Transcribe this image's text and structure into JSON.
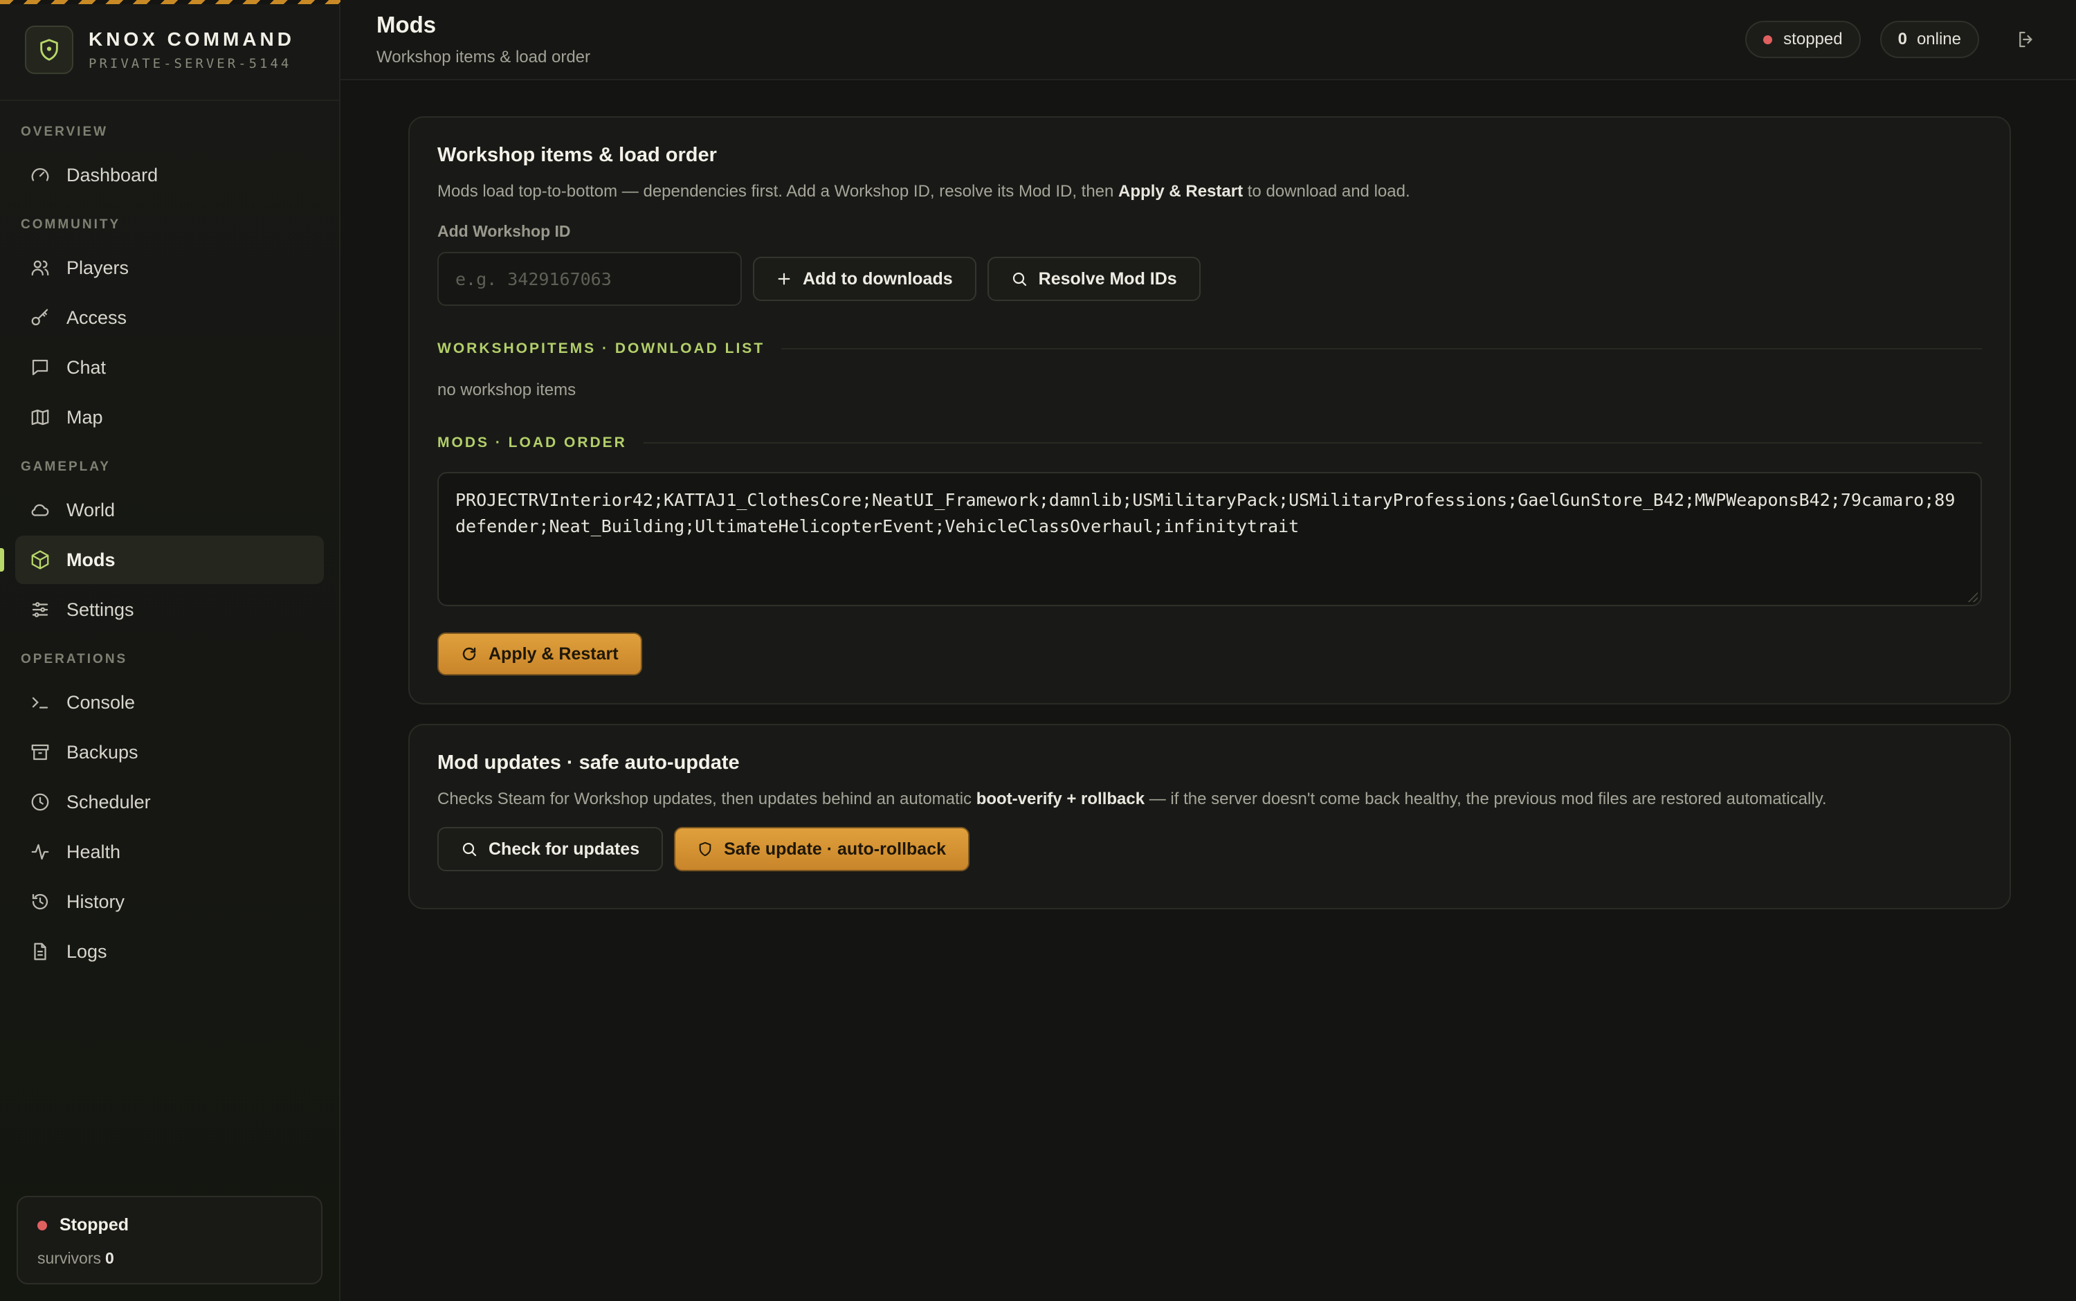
{
  "brand": {
    "title": "KNOX COMMAND",
    "subtitle": "PRIVATE-SERVER-5144"
  },
  "sidebar": {
    "sections": [
      {
        "label": "OVERVIEW",
        "items": [
          {
            "label": "Dashboard",
            "icon": "gauge-icon"
          }
        ]
      },
      {
        "label": "COMMUNITY",
        "items": [
          {
            "label": "Players",
            "icon": "users-icon"
          },
          {
            "label": "Access",
            "icon": "key-icon"
          },
          {
            "label": "Chat",
            "icon": "chat-icon"
          },
          {
            "label": "Map",
            "icon": "map-icon"
          }
        ]
      },
      {
        "label": "GAMEPLAY",
        "items": [
          {
            "label": "World",
            "icon": "cloud-icon"
          },
          {
            "label": "Mods",
            "icon": "package-icon",
            "active": true
          },
          {
            "label": "Settings",
            "icon": "sliders-icon"
          }
        ]
      },
      {
        "label": "OPERATIONS",
        "items": [
          {
            "label": "Console",
            "icon": "terminal-icon"
          },
          {
            "label": "Backups",
            "icon": "archive-icon"
          },
          {
            "label": "Scheduler",
            "icon": "clock-icon"
          },
          {
            "label": "Health",
            "icon": "activity-icon"
          },
          {
            "label": "History",
            "icon": "history-icon"
          },
          {
            "label": "Logs",
            "icon": "file-text-icon"
          }
        ]
      }
    ],
    "status_card": {
      "status": "Stopped",
      "survivors_label": "survivors",
      "survivors_count": "0"
    }
  },
  "header": {
    "title": "Mods",
    "subtitle": "Workshop items & load order",
    "server_status": "stopped",
    "online_count": "0",
    "online_label": "online"
  },
  "workshop_card": {
    "title": "Workshop items & load order",
    "desc_pre": "Mods load top-to-bottom — dependencies first. Add a Workshop ID, resolve its Mod ID, then ",
    "desc_bold": "Apply & Restart",
    "desc_post": " to download and load.",
    "add_label": "Add Workshop ID",
    "input_placeholder": "e.g. 3429167063",
    "add_button": "Add to downloads",
    "resolve_button": "Resolve Mod IDs",
    "download_list_heading": "WORKSHOPITEMS · DOWNLOAD LIST",
    "download_list_empty": "no workshop items",
    "load_order_heading": "MODS · LOAD ORDER",
    "load_order_value": "PROJECTRVInterior42;KATTAJ1_ClothesCore;NeatUI_Framework;damnlib;USMilitaryPack;USMilitaryProfessions;GaelGunStore_B42;MWPWeaponsB42;79camaro;89defender;Neat_Building;UltimateHelicopterEvent;VehicleClassOverhaul;infinitytrait",
    "apply_button": "Apply & Restart"
  },
  "updates_card": {
    "title": "Mod updates · safe auto-update",
    "desc_pre": "Checks Steam for Workshop updates, then updates behind an automatic ",
    "desc_bold": "boot-verify + rollback",
    "desc_post": " — if the server doesn't come back healthy, the previous mod files are restored automatically.",
    "check_button": "Check for updates",
    "safe_button": "Safe update · auto-rollback"
  },
  "colors": {
    "accent": "#d9982f",
    "section_green": "#b3cf6a",
    "stopped_red": "#e06060",
    "background": "#141412"
  }
}
